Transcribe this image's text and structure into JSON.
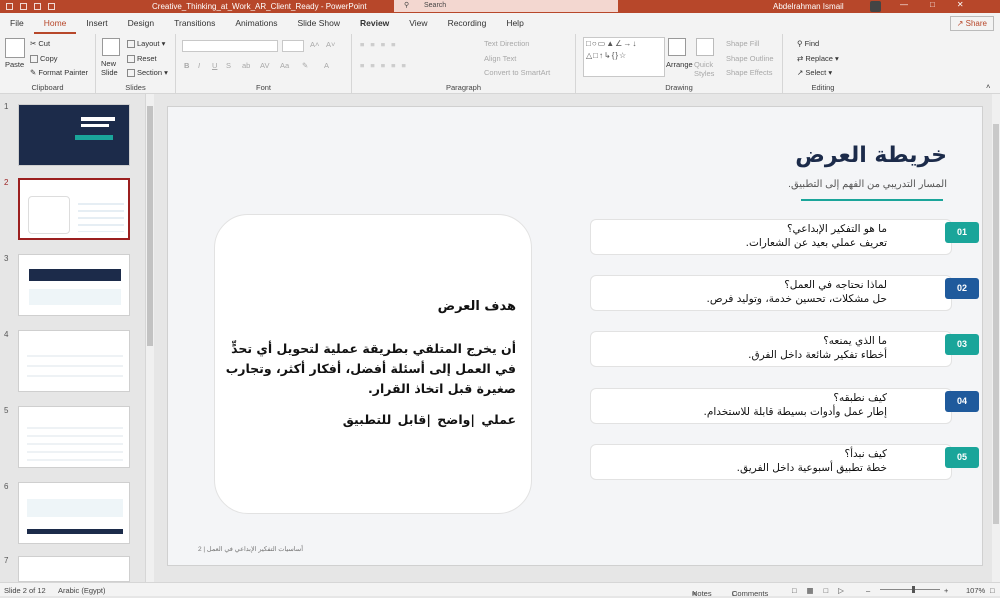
{
  "window": {
    "doc_title": "Creative_Thinking_at_Work_AR_Client_Ready  -  PowerPoint",
    "search_placeholder": "Search",
    "user_name": "Abdelrahman Ismail",
    "min_icon": "minimize-icon",
    "max_icon": "maximize-icon",
    "close_icon": "close-icon",
    "brand_color": "#b7472a"
  },
  "menu": {
    "tabs": [
      "File",
      "Home",
      "Insert",
      "Design",
      "Transitions",
      "Animations",
      "Slide Show",
      "Review",
      "View",
      "Recording",
      "Help"
    ],
    "active": "Home",
    "share": "Share"
  },
  "ribbon": {
    "clipboard": {
      "paste": "Paste",
      "cut": "Cut",
      "copy": "Copy",
      "format_painter": "Format Painter",
      "label": "Clipboard"
    },
    "slides": {
      "new_slide": "New Slide",
      "layout": "Layout",
      "reset": "Reset",
      "section": "Section",
      "label": "Slides"
    },
    "font": {
      "bold": "B",
      "italic": "I",
      "underline": "U",
      "strike": "S",
      "label": "Font"
    },
    "paragraph": {
      "text_direction": "Text Direction",
      "align_text": "Align Text",
      "smartart": "Convert to SmartArt",
      "label": "Paragraph"
    },
    "drawing": {
      "arrange": "Arrange",
      "quick_styles": "Quick Styles",
      "shape_fill": "Shape Fill",
      "shape_outline": "Shape Outline",
      "shape_effects": "Shape Effects",
      "label": "Drawing"
    },
    "editing": {
      "find": "Find",
      "replace": "Replace",
      "select": "Select",
      "label": "Editing"
    }
  },
  "thumbnails": [
    {
      "num": "1"
    },
    {
      "num": "2"
    },
    {
      "num": "3"
    },
    {
      "num": "4"
    },
    {
      "num": "5"
    },
    {
      "num": "6"
    },
    {
      "num": "7"
    }
  ],
  "slide": {
    "title": "خريطة العرض",
    "subtitle": "المسار التدريبي من الفهم إلى التطبيق.",
    "accent": "#1aa59a",
    "items": [
      {
        "num": "01",
        "q": "ما هو التفكير الإبداعي؟",
        "a": "تعريف عملي بعيد عن الشعارات.",
        "color": "#1aa59a"
      },
      {
        "num": "02",
        "q": "لماذا نحتاجه في العمل؟",
        "a": "حل مشكلات، تحسين خدمة، وتوليد فرص.",
        "color": "#1f5a9c"
      },
      {
        "num": "03",
        "q": "ما الذي يمنعه؟",
        "a": "أخطاء تفكير شائعة داخل الفرق.",
        "color": "#1aa59a"
      },
      {
        "num": "04",
        "q": "كيف نطبقه؟",
        "a": "إطار عمل وأدوات بسيطة قابلة للاستخدام.",
        "color": "#1f5a9c"
      },
      {
        "num": "05",
        "q": "كيف نبدأ؟",
        "a": "خطة تطبيق أسبوعية داخل الفريق.",
        "color": "#1aa59a"
      }
    ],
    "goal": {
      "title": "هدف العرض",
      "body": "أن يخرج المتلقي بطريقة عملية لتحويل أي تحدٍّ في العمل إلى أسئلة أفضل، أفكار أكثر، وتجارب صغيرة قبل اتخاذ القرار.",
      "keywords": "عملي  |واضح  |قابل للتطبيق"
    },
    "footer": "أساسيات التفكير الإبداعي في العمل | 2"
  },
  "status": {
    "slide_info": "Slide 2 of 12",
    "language": "Arabic (Egypt)",
    "notes": "Notes",
    "comments": "Comments",
    "zoom": "107%"
  }
}
